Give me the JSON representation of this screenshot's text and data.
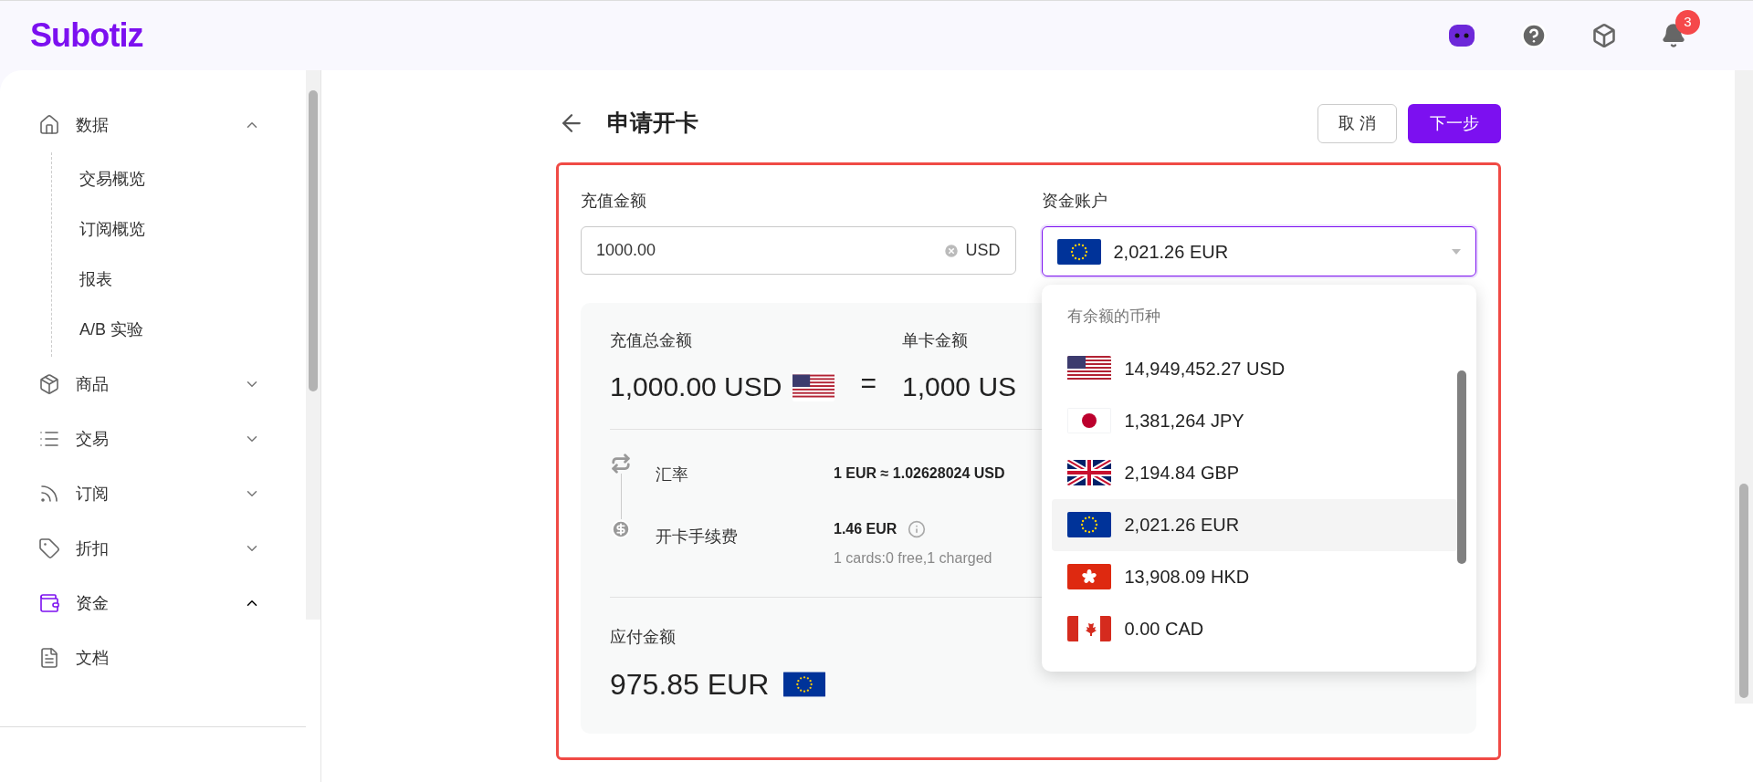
{
  "header": {
    "logo": "Subotiz",
    "notifications": "3"
  },
  "sidebar": {
    "items": [
      {
        "label": "数据",
        "selected": false,
        "expanded": true,
        "children": [
          {
            "label": "交易概览"
          },
          {
            "label": "订阅概览"
          },
          {
            "label": "报表"
          },
          {
            "label": "A/B 实验"
          }
        ]
      },
      {
        "label": "商品",
        "selected": false,
        "expanded": false
      },
      {
        "label": "交易",
        "selected": false,
        "expanded": false
      },
      {
        "label": "订阅",
        "selected": false,
        "expanded": false
      },
      {
        "label": "折扣",
        "selected": false,
        "expanded": false
      },
      {
        "label": "资金",
        "selected": true,
        "expanded": true
      },
      {
        "label": "文档",
        "selected": false
      }
    ]
  },
  "page": {
    "title": "申请开卡",
    "buttons": [
      {
        "label": "取 消",
        "kind": "secondary"
      },
      {
        "label": "下一步",
        "kind": "primary"
      }
    ]
  },
  "form": {
    "amount": {
      "label": "充值金额",
      "value": "1000.00",
      "unit": "USD"
    },
    "account": {
      "label": "资金账户",
      "value": "2,021.26 EUR",
      "expanded": true
    },
    "summary": {
      "total_label": "充值总金额",
      "total": "1,000.00 USD",
      "equals": "=",
      "per_card_label": "单卡金额",
      "per_card": "1,000 US",
      "rate_label": "汇率",
      "rate": "1 EUR ≈ 1.02628024 USD",
      "fee_label": "开卡手续费",
      "fee": "1.46 EUR",
      "fee_note": "1 cards:0 free,1 charged",
      "payable_label": "应付金额",
      "payable": "975.85 EUR"
    }
  },
  "dropdown": {
    "heading": "有余额的币种",
    "options": [
      {
        "label": "14,949,452.27 USD",
        "selected": false
      },
      {
        "label": "1,381,264 JPY",
        "selected": false
      },
      {
        "label": "2,194.84 GBP",
        "selected": false
      },
      {
        "label": "2,021.26 EUR",
        "selected": true
      },
      {
        "label": "13,908.09 HKD",
        "selected": false
      },
      {
        "label": "0.00 CAD",
        "selected": false
      }
    ]
  }
}
